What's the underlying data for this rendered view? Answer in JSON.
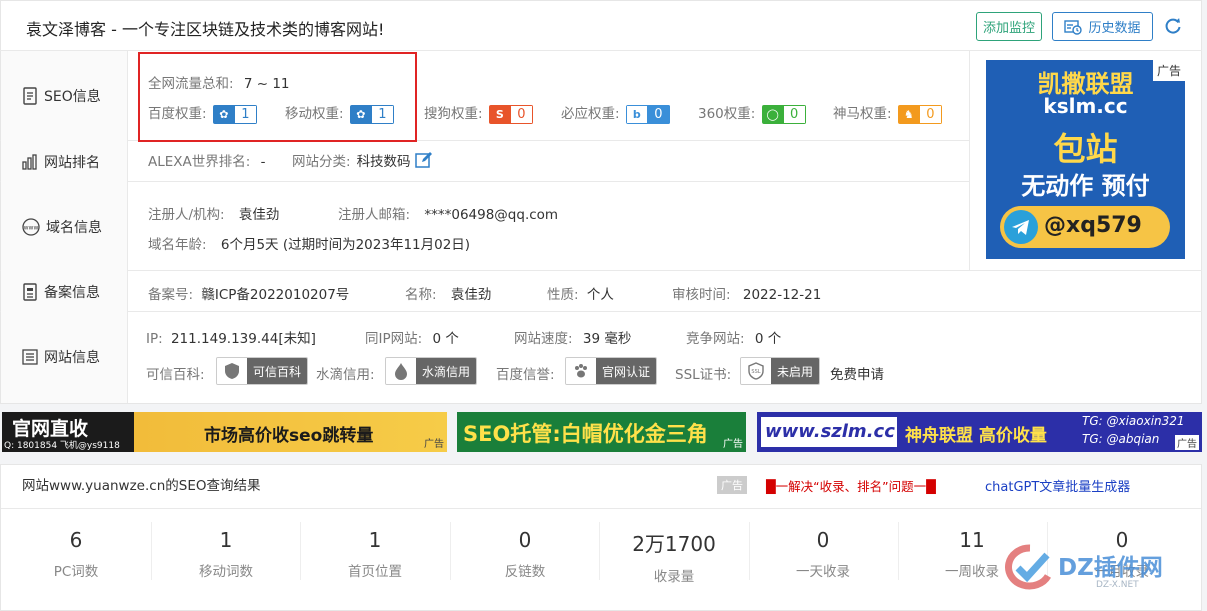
{
  "header": {
    "title": "袁文泽博客 - 一个专注区块链及技术类的博客网站!",
    "add_monitor": "添加监控",
    "history": "历史数据"
  },
  "seo": {
    "row_label": "SEO信息",
    "traffic_label": "全网流量总和:",
    "traffic_value": "7 ~ 11",
    "weights": [
      {
        "label": "百度权重:",
        "value": "1",
        "color": "#2f7fc7",
        "icon": "paw-icon"
      },
      {
        "label": "移动权重:",
        "value": "1",
        "color": "#2f7fc7",
        "icon": "paw-icon"
      },
      {
        "label": "搜狗权重:",
        "value": "0",
        "color": "#e8542a",
        "icon": "sogou-icon"
      },
      {
        "label": "必应权重:",
        "value": "0",
        "color": "#3a8fd9",
        "icon": "bing-icon"
      },
      {
        "label": "360权重:",
        "value": "0",
        "color": "#3bb03b",
        "icon": "360-icon"
      },
      {
        "label": "神马权重:",
        "value": "0",
        "color": "#f39a1e",
        "icon": "shenma-icon"
      }
    ]
  },
  "rank": {
    "row_label": "网站排名",
    "alexa_label": "ALEXA世界排名:",
    "alexa_value": "-",
    "category_label": "网站分类:",
    "category_value": "科技数码"
  },
  "domain": {
    "row_label": "域名信息",
    "registrant_label": "注册人/机构:",
    "registrant_value": "袁佳劲",
    "email_label": "注册人邮箱:",
    "email_value": "****06498@qq.com",
    "age_label": "域名年龄:",
    "age_value": "6个月5天 (过期时间为2023年11月02日)"
  },
  "icp": {
    "row_label": "备案信息",
    "no_label": "备案号:",
    "no_value": "赣ICP备2022010207号",
    "name_label": "名称:",
    "name_value": "袁佳劲",
    "type_label": "性质:",
    "type_value": "个人",
    "date_label": "审核时间:",
    "date_value": "2022-12-21"
  },
  "site": {
    "row_label": "网站信息",
    "ip_label": "IP:",
    "ip_value": "211.149.139.44[未知]",
    "sameip_label": "同IP网站:",
    "sameip_value": "0 个",
    "speed_label": "网站速度:",
    "speed_value": "39 毫秒",
    "competitor_label": "竞争网站:",
    "competitor_value": "0 个",
    "credits": [
      {
        "label": "可信百科:",
        "badge": "可信百科",
        "icon": "shield-icon"
      },
      {
        "label": "水滴信用:",
        "badge": "水滴信用",
        "icon": "drop-icon"
      },
      {
        "label": "百度信誉:",
        "badge": "官网认证",
        "icon": "paw-icon"
      },
      {
        "label": "SSL证书:",
        "badge": "未启用",
        "icon": "ssl-shield-icon"
      }
    ],
    "ssl_apply": "免费申请"
  },
  "side_ad": {
    "line1": "凯撒联盟",
    "line2": "kslm.cc",
    "line3": "包站",
    "line4": "无动作 预付",
    "contact": "@xq579",
    "tag": "广告"
  },
  "banners": [
    {
      "left_big": "官网直收",
      "left_small": "Q: 1801854 飞机@ys9118",
      "main": "市场高价收seo跳转量",
      "tag": "广告"
    },
    {
      "main": "SEO托管:白帽优化金三角",
      "tag": "广告"
    },
    {
      "url": "www.szlm.cc",
      "main": "神舟联盟 高价收量",
      "tg1": "TG: @xiaoxin321",
      "tg2": "TG: @abqian",
      "tag": "广告"
    }
  ],
  "results": {
    "title": "网站www.yuanwze.cn的SEO查询结果",
    "ad_tag": "广告",
    "promo_red": "█一解决“收录、排名”问题一█",
    "promo_blue": "chatGPT文章批量生成器",
    "stats": [
      {
        "value": "6",
        "label": "PC词数"
      },
      {
        "value": "1",
        "label": "移动词数"
      },
      {
        "value": "1",
        "label": "首页位置"
      },
      {
        "value": "0",
        "label": "反链数"
      },
      {
        "value": "2万1700",
        "label": "收录量"
      },
      {
        "value": "0",
        "label": "一天收录"
      },
      {
        "value": "11",
        "label": "一周收录"
      },
      {
        "value": "0",
        "label": "一月收录"
      }
    ]
  },
  "watermark": {
    "text": "DZ插件网",
    "sub": "DZ-X.NET"
  }
}
